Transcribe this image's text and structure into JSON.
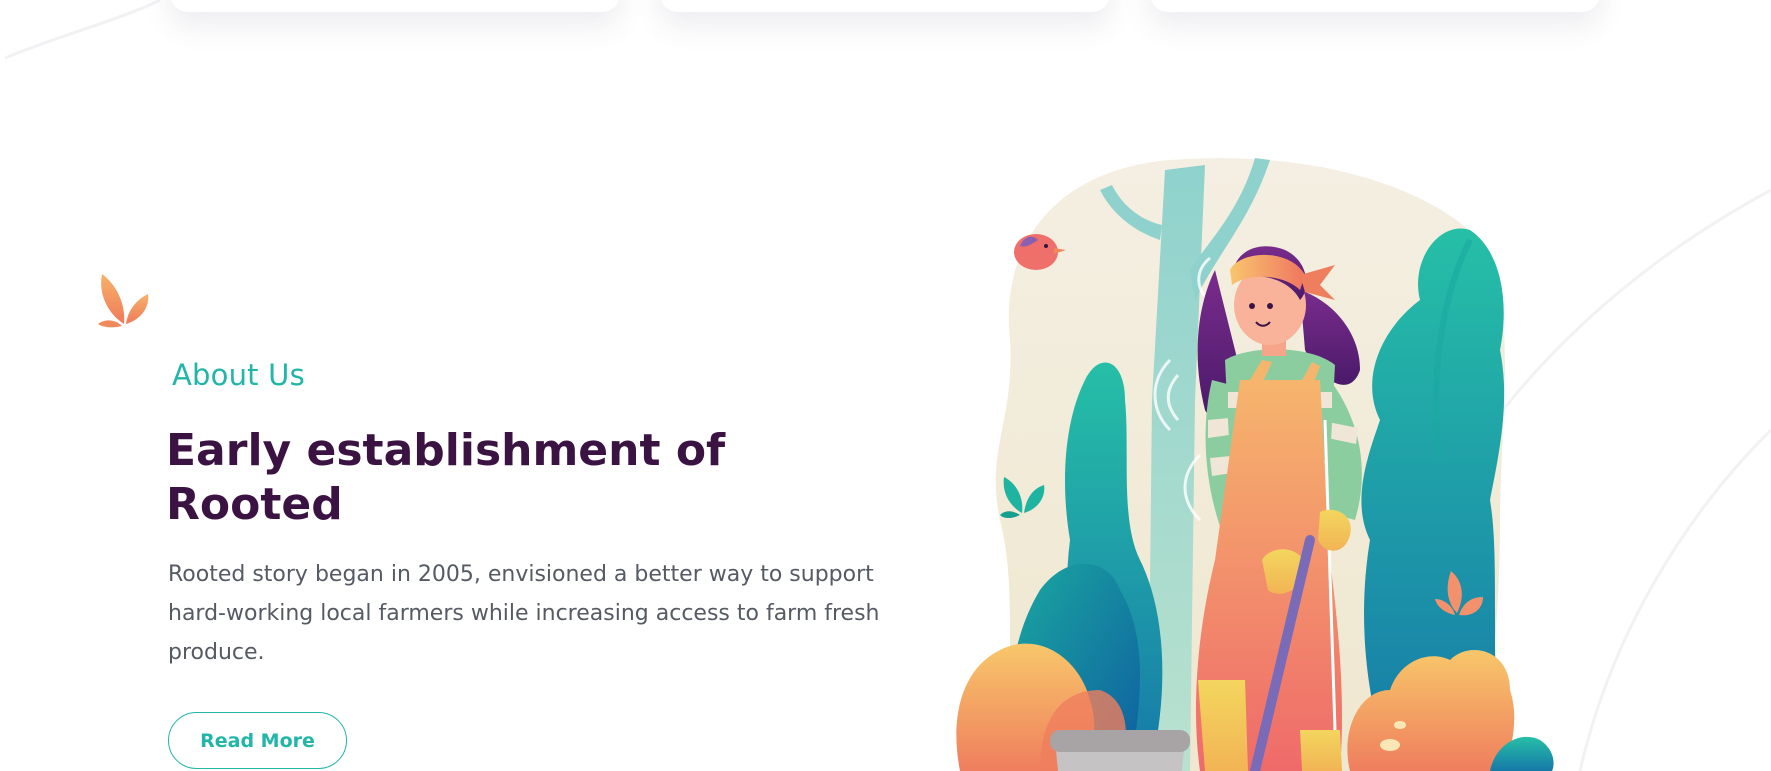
{
  "about": {
    "eyebrow": "About Us",
    "heading": "Early establishment of Rooted",
    "body": "Rooted story began in 2005,  envisioned a better way to support hard-working local farmers while increasing access to farm fresh produce.",
    "cta_label": "Read More"
  },
  "icons": {
    "left_leaf": "leaf-sprout-icon",
    "illustration": "woman-gardener-illustration"
  },
  "colors": {
    "accent": "#21b6a8",
    "heading": "#3a1342",
    "body": "#555a64",
    "leaf_orange": "#f08a5d"
  }
}
